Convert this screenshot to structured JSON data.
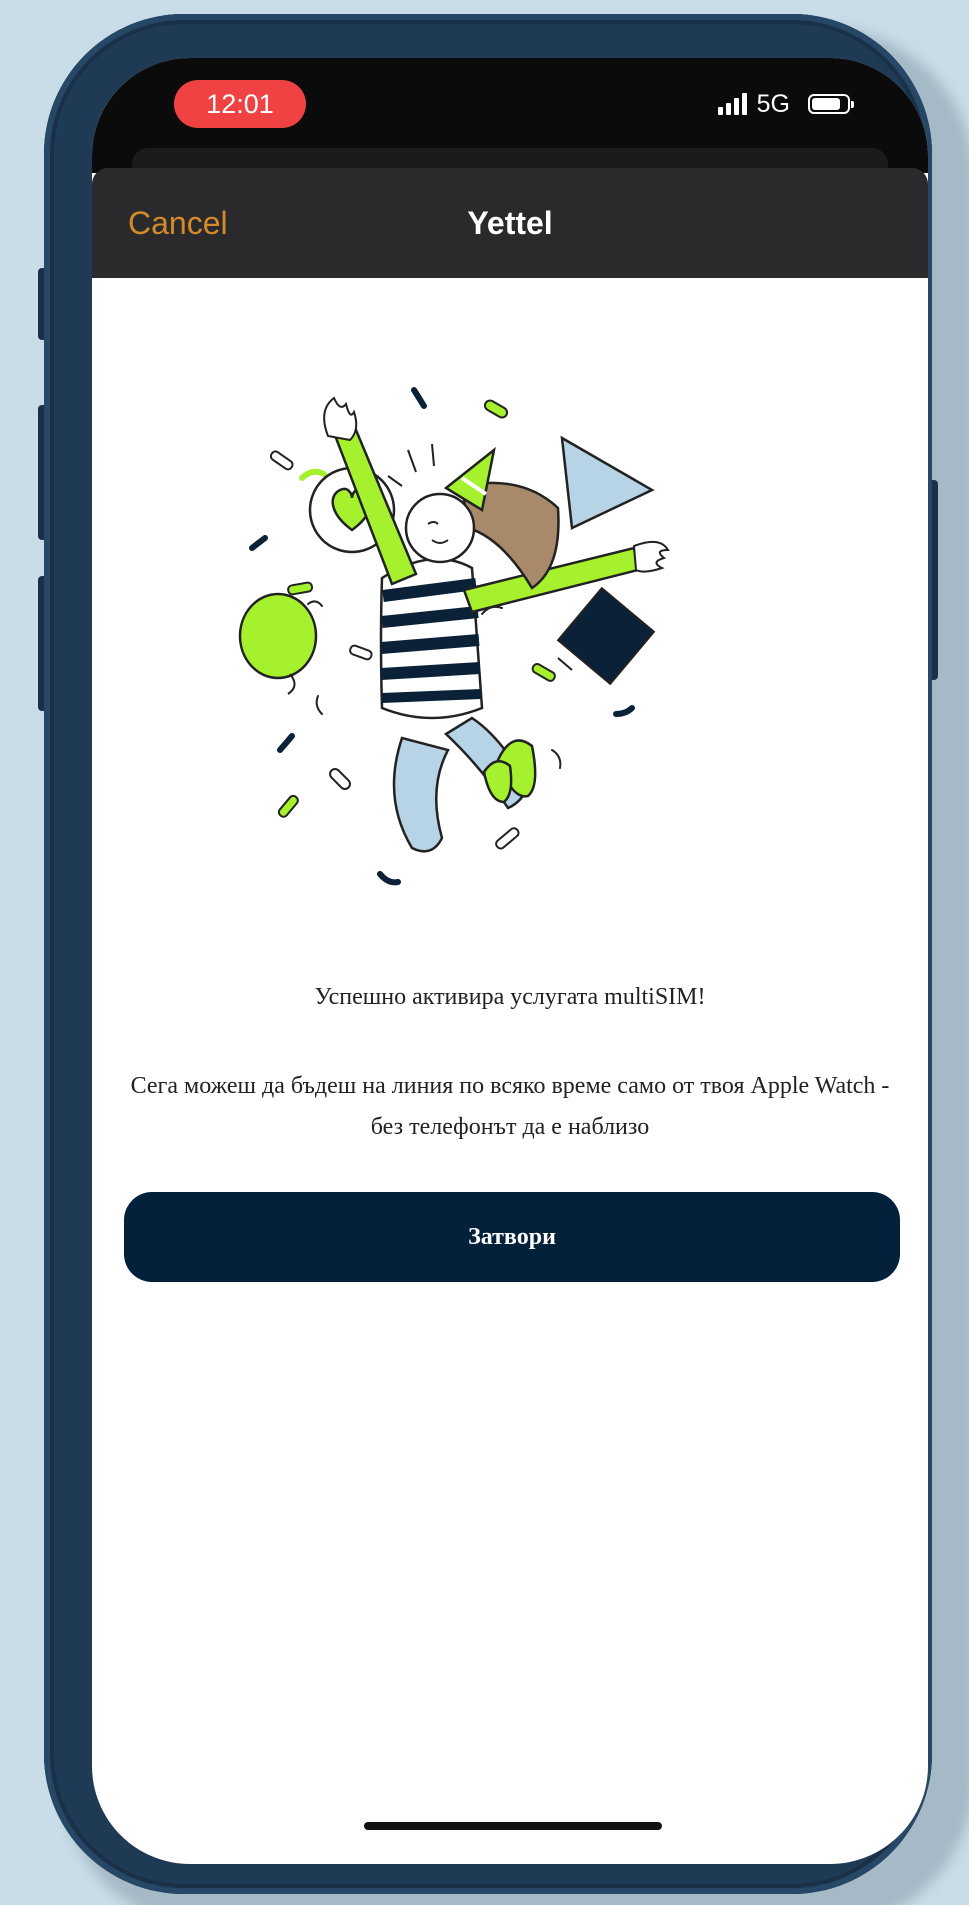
{
  "status_bar": {
    "time": "12:01",
    "network": "5G",
    "icons": [
      "signal-bars-icon",
      "battery-icon"
    ]
  },
  "nav": {
    "cancel_label": "Cancel",
    "title": "Yettel"
  },
  "content": {
    "illustration": "celebrating-person-illustration",
    "success_title": "Успешно активира услугата multiSIM!",
    "success_body": "Сега можеш да бъдеш на линия по всяко време само от твоя Apple Watch - без телефонът да е наблизо"
  },
  "actions": {
    "close_label": "Затвори"
  },
  "colors": {
    "background": "#c8dde8",
    "phone_frame": "#1f3a55",
    "status_bar": "#0b0b0c",
    "time_pill": "#f04242",
    "nav_bar": "#2a2a2c",
    "cancel_accent": "#d58a2a",
    "primary_button": "#03213a",
    "illustration_green": "#a6f12e",
    "illustration_blue": "#b7d3e6",
    "illustration_navy": "#0b2138"
  }
}
